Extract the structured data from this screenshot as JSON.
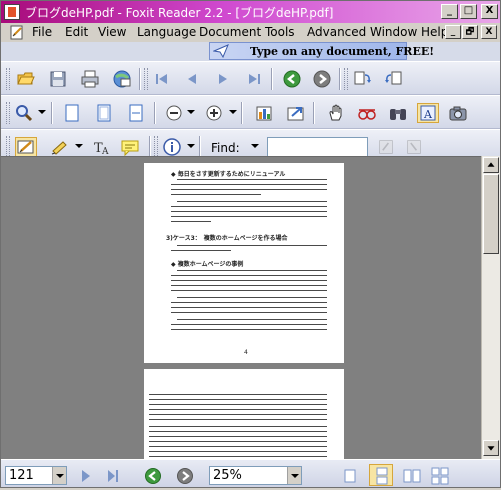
{
  "window": {
    "title": "ブログdeHP.pdf - Foxit Reader 2.2 - [ブログdeHP.pdf]",
    "controls": [
      "_",
      "□",
      "X"
    ],
    "mdi_controls": [
      "_",
      "🗗",
      "X"
    ]
  },
  "menu": {
    "items": [
      "File",
      "Edit",
      "View",
      "Language",
      "Document",
      "Tools",
      "Advanced",
      "Window",
      "Help"
    ]
  },
  "banner": {
    "text": "Type on any document, FREE!"
  },
  "toolbar3": {
    "find_label": "Find:",
    "find_value": ""
  },
  "status": {
    "page_number": "121",
    "zoom": "25%"
  },
  "page1": {
    "heading1": "◆ 毎日をさす更新するためにリニューアル",
    "heading2": "3)ケース3：　複数のホームページを作る場合",
    "heading3": "◆ 複数ホームページの事例",
    "page_no": "4"
  },
  "colors": {
    "title_start": "#a80b7a",
    "title_end": "#e9a7e9",
    "toolbar": "#d3d8e8",
    "doc_bg": "#808080"
  }
}
